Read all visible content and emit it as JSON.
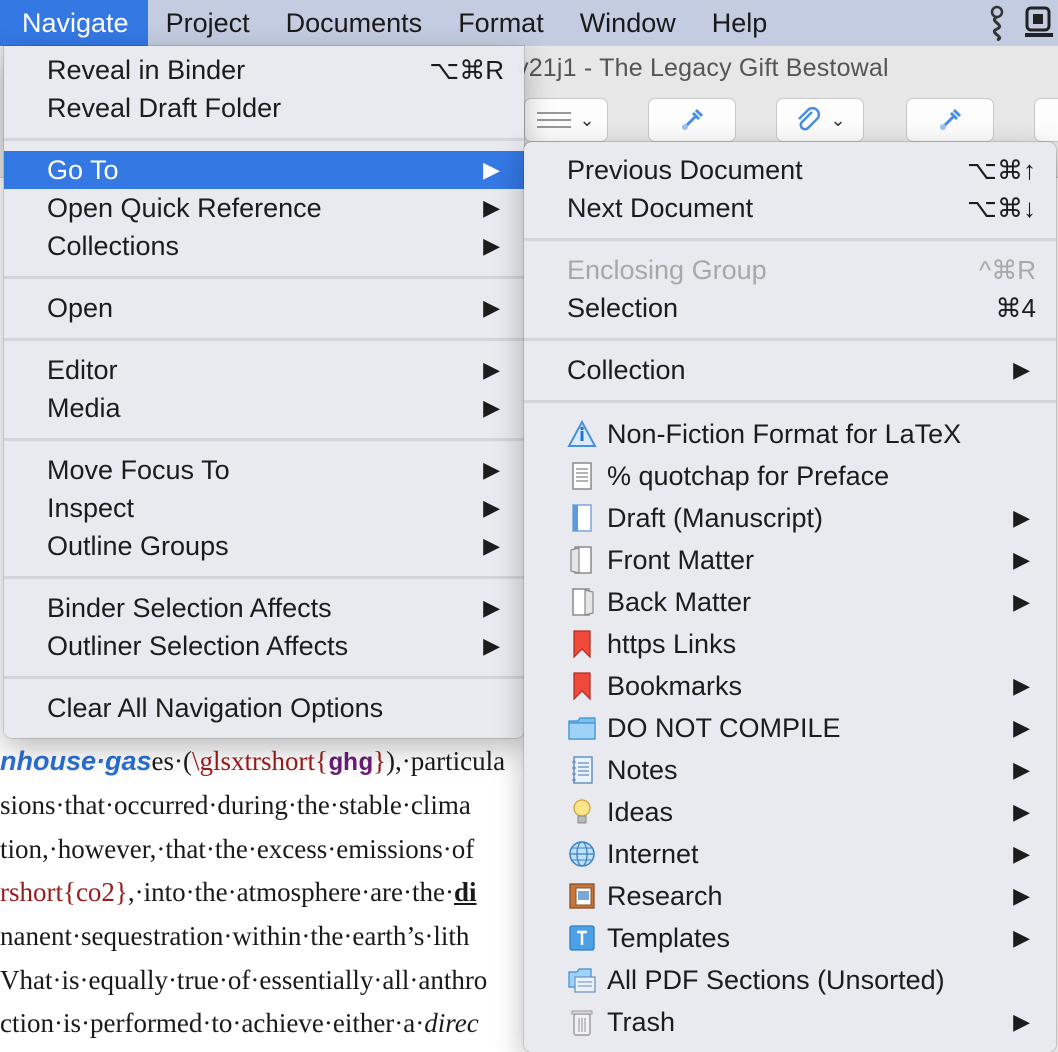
{
  "menubar": {
    "items": [
      {
        "label": "Navigate",
        "active": true
      },
      {
        "label": "Project"
      },
      {
        "label": "Documents"
      },
      {
        "label": "Format"
      },
      {
        "label": "Window"
      },
      {
        "label": "Help"
      }
    ],
    "status_icons": [
      "scrivener-hook-icon",
      "screen-share-icon"
    ]
  },
  "window": {
    "title": "y21j1 - The Legacy Gift Bestowal"
  },
  "navigate_menu": {
    "items": [
      {
        "label": "Reveal in Binder",
        "shortcut": "⌥⌘R"
      },
      {
        "label": "Reveal Draft Folder"
      },
      {
        "label": "Go To",
        "submenu": true,
        "highlighted": true
      },
      {
        "label": "Open Quick Reference",
        "submenu": true
      },
      {
        "label": "Collections",
        "submenu": true
      },
      {
        "label": "Open",
        "submenu": true
      },
      {
        "label": "Editor",
        "submenu": true
      },
      {
        "label": "Media",
        "submenu": true
      },
      {
        "label": "Move Focus To",
        "submenu": true
      },
      {
        "label": "Inspect",
        "submenu": true
      },
      {
        "label": "Outline Groups",
        "submenu": true
      },
      {
        "label": "Binder Selection Affects",
        "submenu": true
      },
      {
        "label": "Outliner Selection Affects",
        "submenu": true
      },
      {
        "label": "Clear All Navigation Options"
      }
    ]
  },
  "goto_menu": {
    "items": [
      {
        "label": "Previous Document",
        "shortcut": "⌥⌘↑"
      },
      {
        "label": "Next Document",
        "shortcut": "⌥⌘↓"
      },
      {
        "label": "Enclosing Group",
        "shortcut": "^⌘R",
        "disabled": true
      },
      {
        "label": "Selection",
        "shortcut": "⌘4"
      },
      {
        "label": "Collection",
        "submenu": true
      }
    ],
    "binder_items": [
      {
        "label": "Non-Fiction Format for LaTeX",
        "icon": "warning-info-icon"
      },
      {
        "label": "% quotchap for Preface",
        "icon": "text-document-icon"
      },
      {
        "label": "Draft (Manuscript)",
        "icon": "draft-folder-icon",
        "submenu": true
      },
      {
        "label": "Front Matter",
        "icon": "front-matter-icon",
        "submenu": true
      },
      {
        "label": "Back Matter",
        "icon": "back-matter-icon",
        "submenu": true
      },
      {
        "label": "https Links",
        "icon": "bookmark-red-icon"
      },
      {
        "label": "Bookmarks",
        "icon": "bookmark-red-icon",
        "submenu": true
      },
      {
        "label": "DO NOT COMPILE",
        "icon": "folder-icon",
        "submenu": true
      },
      {
        "label": "Notes",
        "icon": "notebook-icon",
        "submenu": true
      },
      {
        "label": "Ideas",
        "icon": "lightbulb-icon",
        "submenu": true
      },
      {
        "label": "Internet",
        "icon": "globe-icon",
        "submenu": true
      },
      {
        "label": "Research",
        "icon": "research-icon",
        "submenu": true
      },
      {
        "label": "Templates",
        "icon": "templates-icon",
        "submenu": true
      },
      {
        "label": "All PDF Sections (Unsorted)",
        "icon": "folder-stack-icon"
      },
      {
        "label": "Trash",
        "icon": "trash-icon",
        "submenu": true
      }
    ]
  },
  "editor": {
    "lines": [
      {
        "segments": [
          {
            "t": "nhouse·gas",
            "c": "kw"
          },
          {
            "t": "es·(",
            "c": ""
          },
          {
            "t": "\\glsxtrshort{",
            "c": "red"
          },
          {
            "t": "ghg",
            "c": "arg"
          },
          {
            "t": "}",
            "c": "red"
          },
          {
            "t": "),·particula",
            "c": ""
          }
        ]
      },
      {
        "segments": [
          {
            "t": "sions·that·occurred·during·the·stable·clima",
            "c": ""
          }
        ]
      },
      {
        "segments": [
          {
            "t": "tion,·however,·that·the·excess·emissions·of",
            "c": ""
          }
        ]
      },
      {
        "segments": [
          {
            "t": "rshort{co2}",
            "c": "red"
          },
          {
            "t": ",·into·the·atmosphere·are·the·",
            "c": ""
          },
          {
            "t": "di",
            "c": "bold-u"
          }
        ]
      },
      {
        "segments": [
          {
            "t": "nanent·sequestration·within·the·earth’s·lith",
            "c": ""
          }
        ]
      },
      {
        "segments": [
          {
            "t": "Vhat·is·equally·true·of·essentially·all·anthro",
            "c": ""
          }
        ]
      },
      {
        "segments": [
          {
            "t": "ction·is·performed·to·achieve·either·a·",
            "c": ""
          },
          {
            "t": "direc",
            "c": "ital"
          }
        ]
      }
    ]
  },
  "colors": {
    "menu_highlight": "#3478e4",
    "menubar_bg": "#c3cce0",
    "menu_bg": "#e8eaf0",
    "disabled_text": "#a8a8a8"
  }
}
